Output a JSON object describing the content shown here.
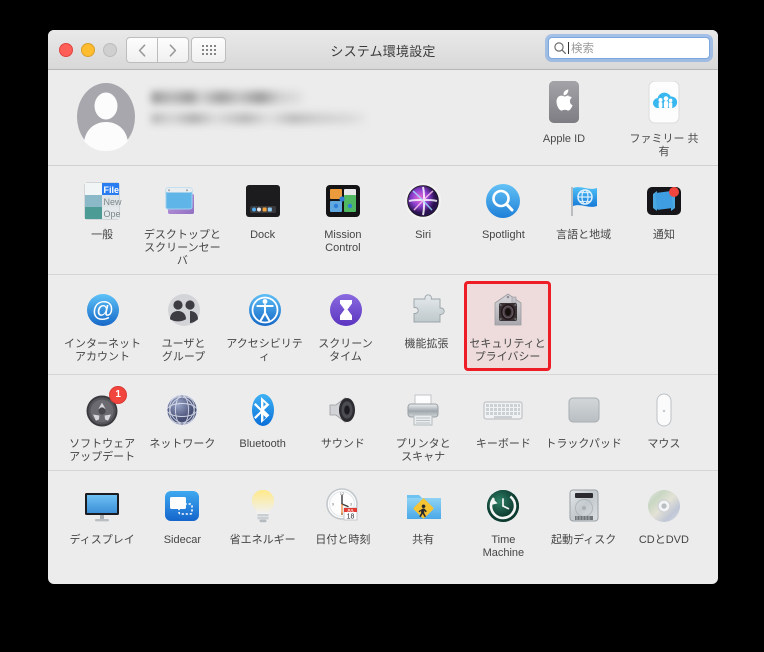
{
  "window": {
    "title": "システム環境設定",
    "traffic_lights": [
      "close",
      "minimize",
      "zoom"
    ],
    "nav": {
      "back": "‹",
      "forward": "›",
      "grid": "grid-view"
    },
    "search": {
      "placeholder": "検索",
      "value": ""
    }
  },
  "account": {
    "name_redacted": true,
    "email_redacted": true,
    "tiles": [
      {
        "label": "Apple ID",
        "icon": "apple-id-icon"
      },
      {
        "label": "ファミリー\n共有",
        "icon": "family-sharing-icon"
      }
    ]
  },
  "rows": [
    {
      "items": [
        {
          "label": "一般",
          "icon": "general-icon"
        },
        {
          "label": "デスクトップと\nスクリーンセーバ",
          "icon": "desktop-screensaver-icon"
        },
        {
          "label": "Dock",
          "icon": "dock-icon"
        },
        {
          "label": "Mission\nControl",
          "icon": "mission-control-icon"
        },
        {
          "label": "Siri",
          "icon": "siri-icon"
        },
        {
          "label": "Spotlight",
          "icon": "spotlight-icon"
        },
        {
          "label": "言語と地域",
          "icon": "language-region-icon"
        },
        {
          "label": "通知",
          "icon": "notifications-icon"
        }
      ]
    },
    {
      "items": [
        {
          "label": "インターネット\nアカウント",
          "icon": "internet-accounts-icon"
        },
        {
          "label": "ユーザと\nグループ",
          "icon": "users-groups-icon"
        },
        {
          "label": "アクセシビリティ",
          "icon": "accessibility-icon"
        },
        {
          "label": "スクリーン\nタイム",
          "icon": "screen-time-icon"
        },
        {
          "label": "機能拡張",
          "icon": "extensions-icon"
        },
        {
          "label": "セキュリティと\nプライバシー",
          "icon": "security-privacy-icon",
          "highlighted": true
        }
      ]
    },
    {
      "items": [
        {
          "label": "ソフトウェア\nアップデート",
          "icon": "software-update-icon",
          "badge": "1"
        },
        {
          "label": "ネットワーク",
          "icon": "network-icon"
        },
        {
          "label": "Bluetooth",
          "icon": "bluetooth-icon"
        },
        {
          "label": "サウンド",
          "icon": "sound-icon"
        },
        {
          "label": "プリンタと\nスキャナ",
          "icon": "printers-scanners-icon"
        },
        {
          "label": "キーボード",
          "icon": "keyboard-icon"
        },
        {
          "label": "トラックパッド",
          "icon": "trackpad-icon"
        },
        {
          "label": "マウス",
          "icon": "mouse-icon"
        }
      ]
    },
    {
      "items": [
        {
          "label": "ディスプレイ",
          "icon": "displays-icon"
        },
        {
          "label": "Sidecar",
          "icon": "sidecar-icon"
        },
        {
          "label": "省エネルギー",
          "icon": "energy-saver-icon"
        },
        {
          "label": "日付と時刻",
          "icon": "date-time-icon"
        },
        {
          "label": "共有",
          "icon": "sharing-icon"
        },
        {
          "label": "Time\nMachine",
          "icon": "time-machine-icon"
        },
        {
          "label": "起動ディスク",
          "icon": "startup-disk-icon"
        },
        {
          "label": "CDとDVD",
          "icon": "cd-dvd-icon"
        }
      ]
    }
  ],
  "highlight": {
    "color": "#ee1c25",
    "target": "セキュリティとプライバシー"
  },
  "date_icon_text": {
    "month": "JUL",
    "day": "18"
  }
}
